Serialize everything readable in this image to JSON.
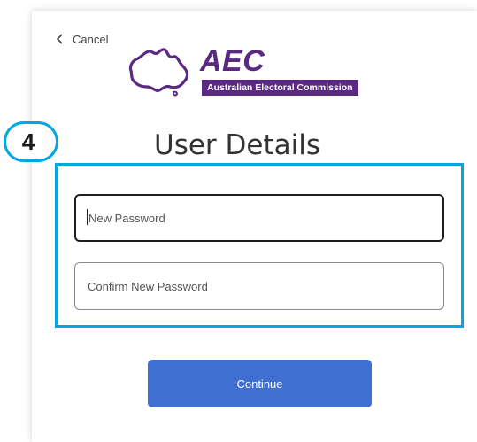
{
  "header": {
    "cancel_label": "Cancel"
  },
  "logo": {
    "abbrev": "AEC",
    "full_name": "Australian Electoral Commission"
  },
  "step": {
    "number": "4"
  },
  "form": {
    "title": "User Details",
    "new_password_placeholder": "New Password",
    "confirm_password_placeholder": "Confirm New Password",
    "continue_label": "Continue"
  },
  "colors": {
    "brand_purple": "#5a2a82",
    "highlight_blue": "#00a7e1",
    "button_blue": "#3f6fd1"
  },
  "icons": {
    "back": "chevron-left-icon",
    "logo_mark": "australia-map-icon"
  }
}
